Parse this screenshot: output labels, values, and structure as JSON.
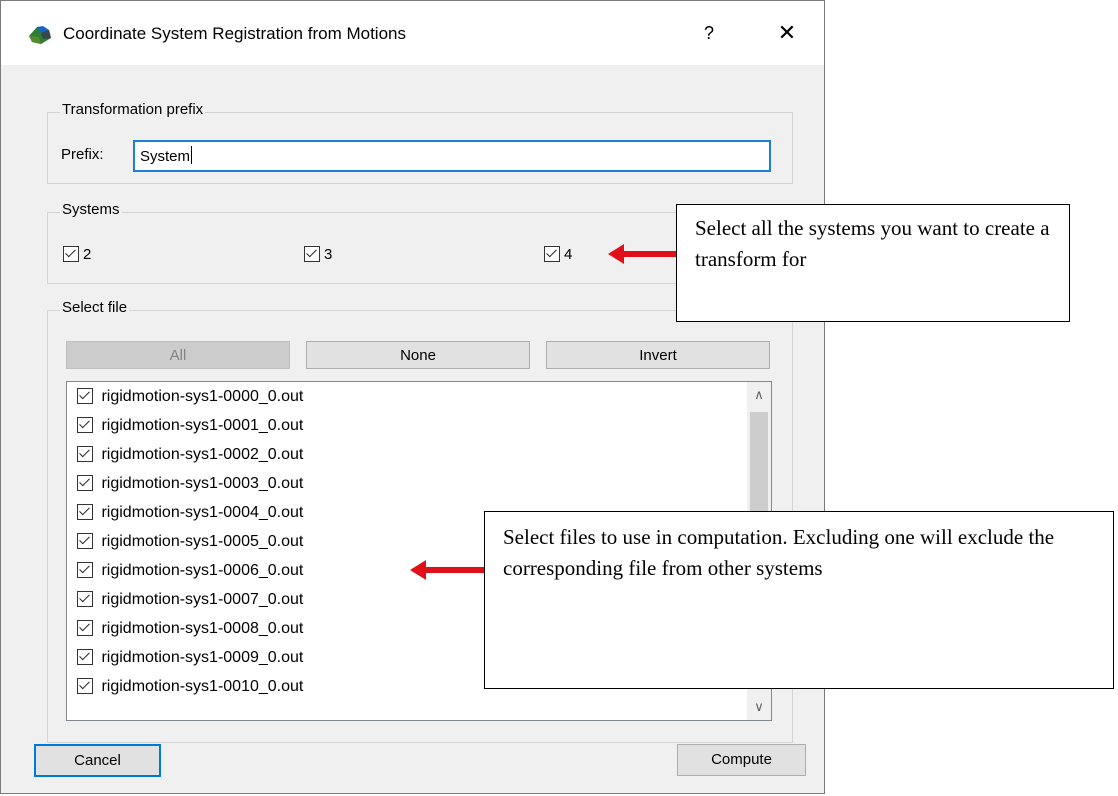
{
  "window": {
    "title": "Coordinate System Registration from Motions",
    "help_label": "?",
    "close_label": "✕",
    "icon": "app-logo-icon"
  },
  "prefix_group": {
    "title": "Transformation prefix",
    "label": "Prefix:",
    "value": "System"
  },
  "systems_group": {
    "title": "Systems",
    "items": [
      {
        "label": "2",
        "checked": true
      },
      {
        "label": "3",
        "checked": true
      },
      {
        "label": "4",
        "checked": true
      }
    ]
  },
  "file_group": {
    "title": "Select file",
    "buttons": {
      "all": "All",
      "none": "None",
      "invert": "Invert"
    },
    "files": [
      "rigidmotion-sys1-0000_0.out",
      "rigidmotion-sys1-0001_0.out",
      "rigidmotion-sys1-0002_0.out",
      "rigidmotion-sys1-0003_0.out",
      "rigidmotion-sys1-0004_0.out",
      "rigidmotion-sys1-0005_0.out",
      "rigidmotion-sys1-0006_0.out",
      "rigidmotion-sys1-0007_0.out",
      "rigidmotion-sys1-0008_0.out",
      "rigidmotion-sys1-0009_0.out",
      "rigidmotion-sys1-0010_0.out"
    ]
  },
  "footer": {
    "cancel_label": "Cancel",
    "compute_label": "Compute"
  },
  "annotations": {
    "systems_note": "Select all the systems you want to create a transform for",
    "files_note": "Select files to use in computation. Excluding one will exclude the corresponding file from other systems",
    "arrow_color": "#e0101a"
  }
}
